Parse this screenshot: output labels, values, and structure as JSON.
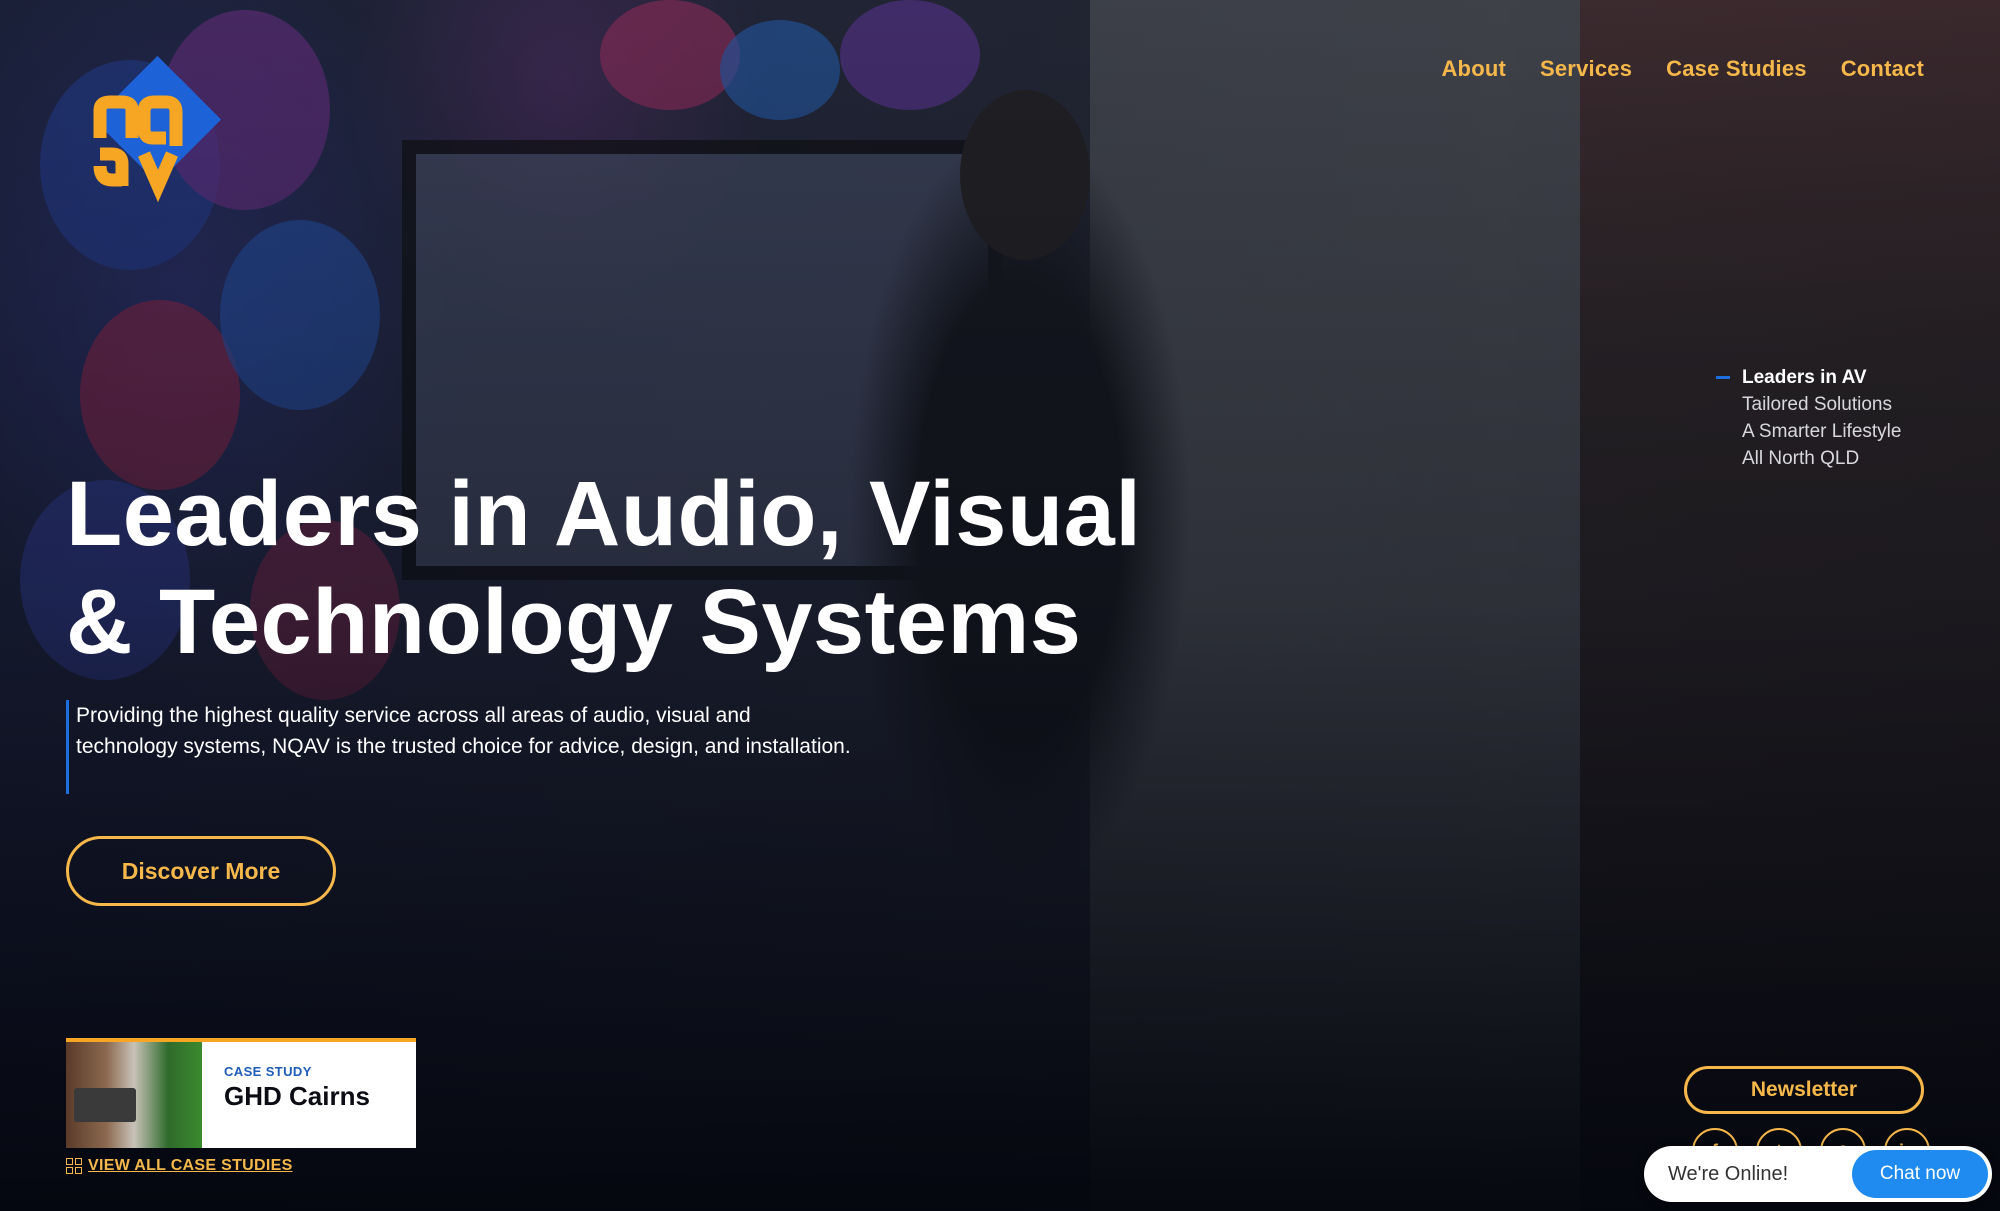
{
  "brand": {
    "logo_text": "NQAV",
    "accent_color": "#f6b84a",
    "secondary_color": "#1d6fe0"
  },
  "nav": {
    "items": [
      {
        "label": "About"
      },
      {
        "label": "Services"
      },
      {
        "label": "Case Studies"
      },
      {
        "label": "Contact"
      }
    ]
  },
  "side_list": {
    "items": [
      {
        "label": "Leaders in AV",
        "active": true
      },
      {
        "label": "Tailored Solutions",
        "active": false
      },
      {
        "label": "A Smarter Lifestyle",
        "active": false
      },
      {
        "label": "All North QLD",
        "active": false
      }
    ]
  },
  "hero": {
    "title_line1": "Leaders in Audio, Visual",
    "title_line2": "& Technology Systems",
    "description": "Providing the highest quality service across all areas of audio, visual and technology systems, NQAV is the trusted choice for advice, design, and installation.",
    "cta_label": "Discover More"
  },
  "case_study": {
    "label": "CASE STUDY",
    "name": "GHD Cairns",
    "view_all_label": "VIEW ALL CASE STUDIES"
  },
  "newsletter": {
    "label": "Newsletter"
  },
  "socials": [
    {
      "icon": "facebook-icon"
    },
    {
      "icon": "twitter-icon"
    },
    {
      "icon": "instagram-icon"
    },
    {
      "icon": "linkedin-icon"
    }
  ],
  "chat": {
    "status": "We're Online!",
    "button_label": "Chat now"
  }
}
